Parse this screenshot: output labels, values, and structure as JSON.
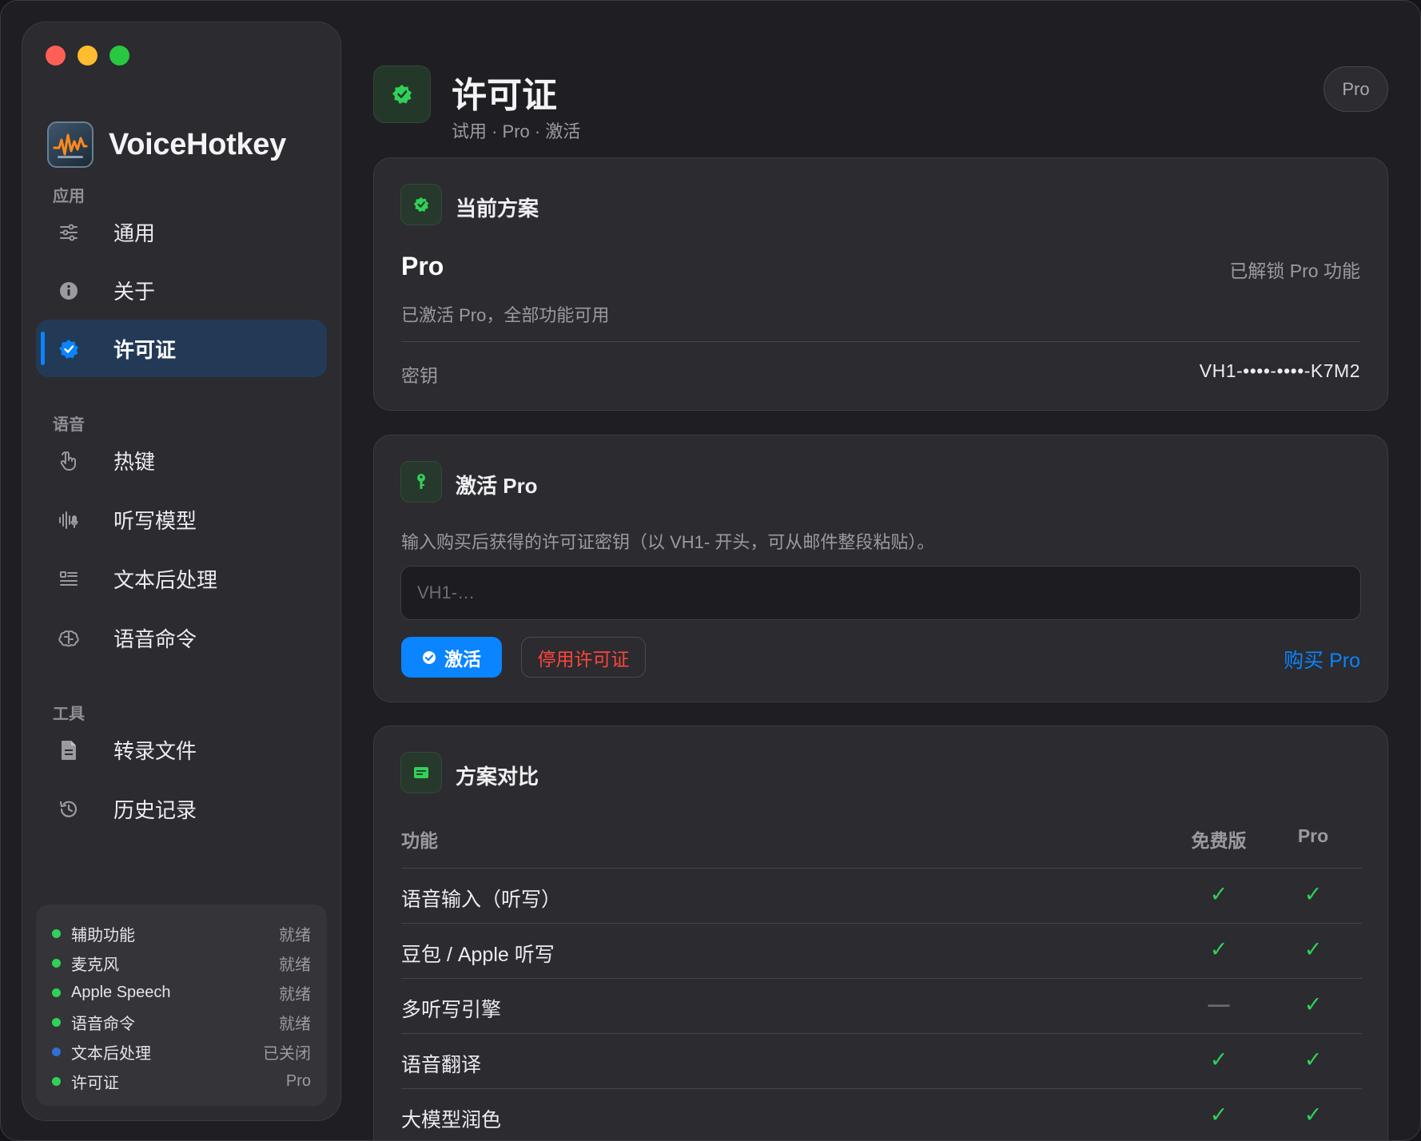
{
  "sidebar": {
    "app_name": "VoiceHotkey",
    "sections": {
      "app": "应用",
      "voice": "语音",
      "tools": "工具"
    },
    "items": [
      {
        "label": "通用",
        "icon": "sliders-icon"
      },
      {
        "label": "关于",
        "icon": "info-icon"
      },
      {
        "label": "许可证",
        "icon": "checkmark-seal-icon",
        "active": true
      },
      {
        "label": "热键",
        "icon": "hand-pointer-icon"
      },
      {
        "label": "听写模型",
        "icon": "waveform-mic-icon"
      },
      {
        "label": "文本后处理",
        "icon": "text-format-icon"
      },
      {
        "label": "语音命令",
        "icon": "brain-icon"
      },
      {
        "label": "转录文件",
        "icon": "document-icon"
      },
      {
        "label": "历史记录",
        "icon": "history-clock-icon"
      }
    ],
    "status": [
      {
        "name": "辅助功能",
        "value": "就绪",
        "color": "#30d158"
      },
      {
        "name": "麦克风",
        "value": "就绪",
        "color": "#30d158"
      },
      {
        "name": "Apple Speech",
        "value": "就绪",
        "color": "#30d158"
      },
      {
        "name": "语音命令",
        "value": "就绪",
        "color": "#30d158"
      },
      {
        "name": "文本后处理",
        "value": "已关闭",
        "color": "#2f6fd4"
      },
      {
        "name": "许可证",
        "value": "Pro",
        "color": "#30d158"
      }
    ]
  },
  "header": {
    "title": "许可证",
    "subtitle": "试用 · Pro · 激活",
    "badge": "Pro"
  },
  "current_plan": {
    "title": "当前方案",
    "plan_name": "Pro",
    "unlocked_text": "已解锁 Pro 功能",
    "description": "已激活 Pro，全部功能可用",
    "key_label": "密钥",
    "key_value": "VH1-••••-••••-K7M2"
  },
  "activate": {
    "title": "激活 Pro",
    "description": "输入购买后获得的许可证密钥（以 VH1- 开头，可从邮件整段粘贴）。",
    "input_placeholder": "VH1-…",
    "input_value": "",
    "activate_label": "激活",
    "deactivate_label": "停用许可证",
    "buy_label": "购买 Pro"
  },
  "comparison": {
    "title": "方案对比",
    "columns": [
      "功能",
      "免费版",
      "Pro"
    ],
    "rows": [
      {
        "feature": "语音输入（听写）",
        "free": "✓",
        "pro": "✓"
      },
      {
        "feature": "豆包 / Apple 听写",
        "free": "✓",
        "pro": "✓"
      },
      {
        "feature": "多听写引擎",
        "free": "—",
        "pro": "✓"
      },
      {
        "feature": "语音翻译",
        "free": "✓",
        "pro": "✓"
      },
      {
        "feature": "大模型润色",
        "free": "✓",
        "pro": "✓"
      }
    ]
  },
  "colors": {
    "accent": "#0a84ff",
    "success": "#30d158",
    "danger": "#ff453a"
  }
}
